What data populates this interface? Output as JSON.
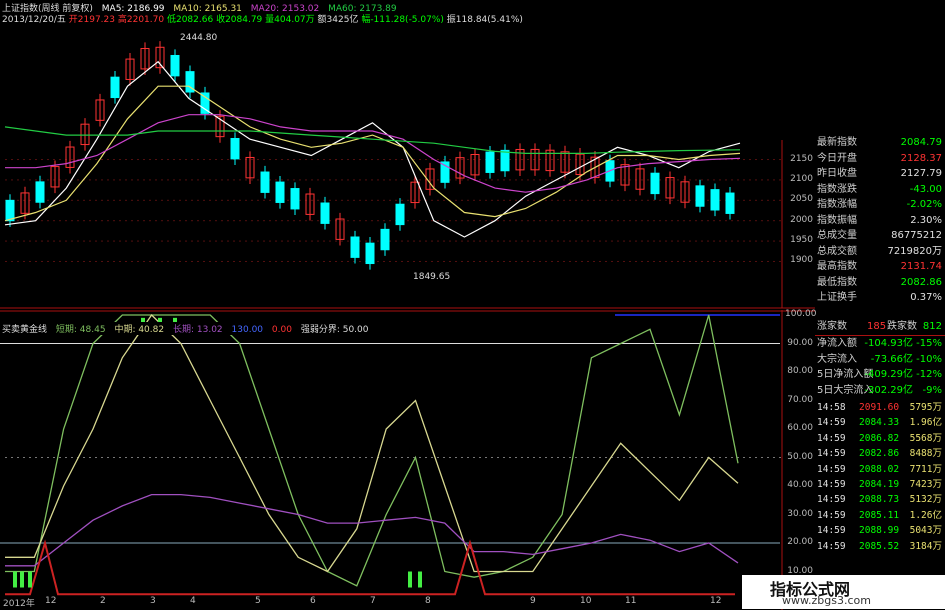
{
  "header": {
    "title": "上证指数(周线 前复权)",
    "ma5": "MA5: 2186.99",
    "ma10": "MA10: 2165.31",
    "ma20": "MA20: 2153.02",
    "ma60": "MA60: 2173.89",
    "line2_date": "2013/12/20/五",
    "line2_open": "开2197.23",
    "line2_high": "高2201.70",
    "line2_low": "低2082.66",
    "line2_close": "收2084.79",
    "line2_vol": "量404.07万",
    "line2_amt": "额3425亿",
    "line2_chg": "幅-111.28(-5.07%)",
    "line2_amp": "振118.84(5.41%)"
  },
  "indicator": {
    "name": "买卖黄金线",
    "short": "短期: 48.45",
    "mid": "中期: 40.82",
    "long": "长期: 13.02",
    "extra1": "130.00",
    "extra2": "0.00",
    "split": "强弱分界: 50.00"
  },
  "price_annotations": {
    "high": "2444.80",
    "low": "1849.65"
  },
  "price_axis": [
    "2150",
    "2100",
    "2050",
    "2000",
    "1950",
    "1900"
  ],
  "osc_axis": [
    "100.00",
    "90.00",
    "80.00",
    "70.00",
    "60.00",
    "50.00",
    "40.00",
    "30.00",
    "20.00",
    "10.00"
  ],
  "x_labels": [
    "2012年",
    "12",
    "2",
    "3",
    "4",
    "5",
    "6",
    "7",
    "8",
    "9",
    "10",
    "11",
    "12"
  ],
  "quote_panel": [
    {
      "label": "最新指数",
      "value": "2084.79",
      "color": "#00ff00"
    },
    {
      "label": "今日开盘",
      "value": "2128.37",
      "color": "#ff3333"
    },
    {
      "label": "昨日收盘",
      "value": "2127.79",
      "color": "#e0e0e0"
    },
    {
      "label": "指数涨跌",
      "value": "-43.00",
      "color": "#00ff00"
    },
    {
      "label": "指数涨幅",
      "value": "-2.02%",
      "color": "#00ff00"
    },
    {
      "label": "指数振幅",
      "value": "2.30%",
      "color": "#e0e0e0"
    },
    {
      "label": "总成交量",
      "value": "86775212",
      "color": "#e0e0e0"
    },
    {
      "label": "总成交额",
      "value": "7219820万",
      "color": "#e0e0e0"
    },
    {
      "label": "最高指数",
      "value": "2131.74",
      "color": "#ff3333"
    },
    {
      "label": "最低指数",
      "value": "2082.86",
      "color": "#00ff00"
    },
    {
      "label": "上证换手",
      "value": "0.37%",
      "color": "#e0e0e0"
    }
  ],
  "updown": {
    "up_label": "涨家数",
    "up_value": "185",
    "down_label": "跌家数",
    "down_value": "812"
  },
  "flows": [
    {
      "label": "净流入额",
      "value": "-104.93亿",
      "pct": "-15%"
    },
    {
      "label": "大宗流入",
      "value": "-73.66亿",
      "pct": "-10%"
    },
    {
      "label": "5日净流入额",
      "value": "-409.29亿",
      "pct": "-12%"
    },
    {
      "label": "5日大宗流入",
      "value": "-302.29亿",
      "pct": "-9%"
    }
  ],
  "ticks": [
    {
      "time": "14:58",
      "price": "2091.60",
      "vol": "5795万"
    },
    {
      "time": "14:59",
      "price": "2084.33",
      "vol": "1.96亿"
    },
    {
      "time": "14:59",
      "price": "2086.82",
      "vol": "5568万"
    },
    {
      "time": "14:59",
      "price": "2082.86",
      "vol": "8488万"
    },
    {
      "time": "14:59",
      "price": "2088.02",
      "vol": "7711万"
    },
    {
      "time": "14:59",
      "price": "2084.19",
      "vol": "7423万"
    },
    {
      "time": "14:59",
      "price": "2088.73",
      "vol": "5132万"
    },
    {
      "time": "14:59",
      "price": "2085.11",
      "vol": "1.26亿"
    },
    {
      "time": "14:59",
      "price": "2088.99",
      "vol": "5043万"
    },
    {
      "time": "14:59",
      "price": "2085.52",
      "vol": "3184万"
    }
  ],
  "watermark": {
    "title": "指标公式网",
    "url": "www.zbgs3.com"
  },
  "colors": {
    "up": "#ff3333",
    "down": "#00ffff",
    "ma5": "#ffffff",
    "ma10": "#e8e070",
    "ma20": "#cc44cc",
    "ma60": "#22cc44",
    "grid": "#aa1111",
    "short": "#7fbf5f",
    "mid": "#d8d890",
    "long": "#a050c0",
    "base": "#cc2222"
  },
  "chart_data": [
    {
      "type": "line",
      "title": "上证指数(周线 前复权)",
      "series": [
        {
          "name": "MA5",
          "values": [
            1990,
            2000,
            2080,
            2200,
            2330,
            2390,
            2300,
            2250,
            2200,
            2180,
            2160,
            2200,
            2240,
            2180,
            2000,
            1960,
            2000,
            2060,
            2100,
            2140,
            2180,
            2160,
            2130,
            2170,
            2190
          ]
        },
        {
          "name": "MA10",
          "values": [
            2000,
            2020,
            2050,
            2140,
            2250,
            2330,
            2330,
            2280,
            2230,
            2200,
            2180,
            2190,
            2210,
            2180,
            2080,
            2020,
            2010,
            2030,
            2070,
            2120,
            2160,
            2160,
            2150,
            2160,
            2165
          ]
        },
        {
          "name": "MA20",
          "values": [
            2130,
            2130,
            2140,
            2160,
            2200,
            2240,
            2260,
            2260,
            2250,
            2230,
            2220,
            2220,
            2220,
            2200,
            2150,
            2110,
            2080,
            2070,
            2080,
            2100,
            2130,
            2140,
            2145,
            2150,
            2153
          ]
        },
        {
          "name": "MA60",
          "values": [
            2230,
            2220,
            2210,
            2210,
            2210,
            2220,
            2220,
            2220,
            2220,
            2215,
            2210,
            2205,
            2200,
            2195,
            2190,
            2180,
            2170,
            2165,
            2165,
            2165,
            2168,
            2170,
            2172,
            2173,
            2174
          ]
        }
      ],
      "ylim": [
        1830,
        2480
      ]
    },
    {
      "type": "line",
      "title": "买卖黄金线",
      "series": [
        {
          "name": "短期",
          "values": [
            10,
            10,
            60,
            90,
            100,
            100,
            100,
            100,
            90,
            60,
            30,
            10,
            5,
            30,
            50,
            10,
            8,
            10,
            15,
            30,
            85,
            90,
            95,
            65,
            100,
            48
          ]
        },
        {
          "name": "中期",
          "values": [
            15,
            15,
            40,
            60,
            85,
            100,
            90,
            70,
            50,
            30,
            15,
            10,
            25,
            60,
            70,
            40,
            10,
            10,
            10,
            25,
            40,
            55,
            45,
            35,
            50,
            41
          ]
        },
        {
          "name": "长期",
          "values": [
            12,
            12,
            20,
            28,
            33,
            37,
            37,
            36,
            34,
            32,
            30,
            27,
            27,
            28,
            29,
            27,
            17,
            17,
            16,
            18,
            20,
            23,
            21,
            17,
            20,
            13
          ]
        }
      ],
      "ylim": [
        0,
        100
      ]
    }
  ]
}
